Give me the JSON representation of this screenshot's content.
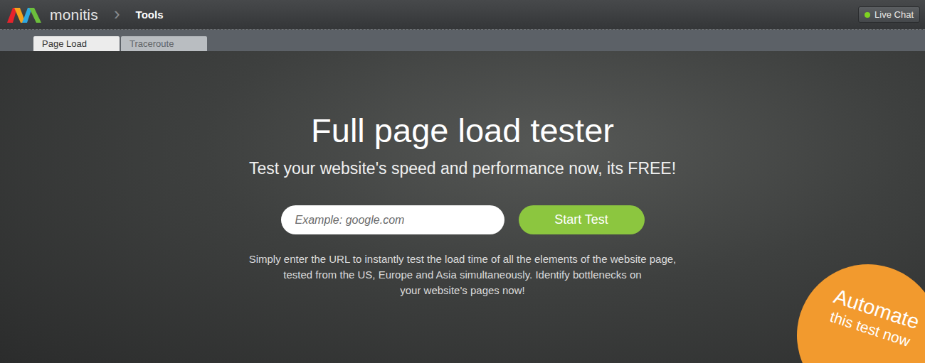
{
  "header": {
    "brand": "monitis",
    "separator": "›",
    "section": "Tools",
    "live_chat": {
      "label": "Live Chat",
      "online": true
    }
  },
  "tabs": [
    {
      "label": "Page Load",
      "selected": true
    },
    {
      "label": "Traceroute",
      "selected": false
    }
  ],
  "hero": {
    "title": "Full page load tester",
    "subtitle": "Test your website's speed and performance now, its FREE!",
    "input": {
      "placeholder": "Example: google.com"
    },
    "button": "Start Test",
    "description": [
      "Simply enter the URL to instantly test the load time of all the elements of the website page,",
      "tested from the US, Europe and Asia simultaneously. Identify bottlenecks on",
      "your website's pages now!"
    ]
  },
  "badge": [
    "Automate",
    "this test now"
  ]
}
